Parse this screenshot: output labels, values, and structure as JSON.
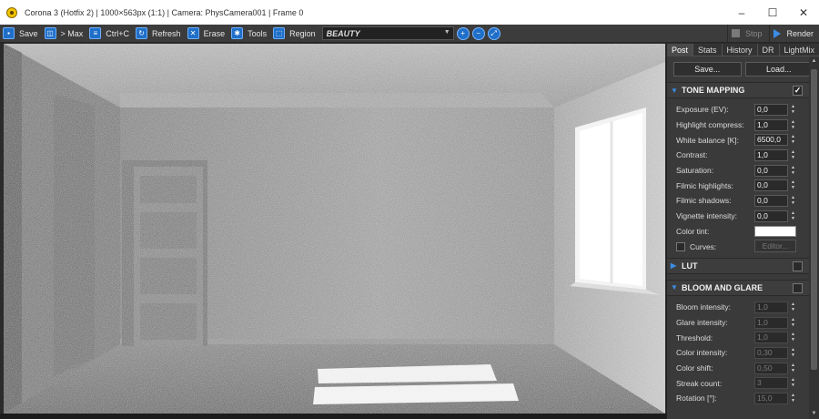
{
  "window": {
    "title": "Corona 3 (Hotfix 2) | 1000×563px (1:1) | Camera: PhysCamera001 | Frame 0",
    "controls": [
      "–",
      "☐",
      "✕"
    ]
  },
  "toolbar": {
    "save": "Save",
    "max": "> Max",
    "copy": "Ctrl+C",
    "refresh": "Refresh",
    "erase": "Erase",
    "tools": "Tools",
    "region": "Region",
    "channel": "BEAUTY",
    "stop": "Stop",
    "render": "Render"
  },
  "panel": {
    "tabs": [
      "Post",
      "Stats",
      "History",
      "DR",
      "LightMix"
    ],
    "save_btn": "Save...",
    "load_btn": "Load...",
    "tone_mapping": {
      "title": "TONE MAPPING",
      "exposure_label": "Exposure (EV):",
      "exposure_value": "0,0",
      "highlight_label": "Highlight compress:",
      "highlight_value": "1,0",
      "wb_label": "White balance [K]:",
      "wb_value": "6500,0",
      "contrast_label": "Contrast:",
      "contrast_value": "1,0",
      "saturation_label": "Saturation:",
      "saturation_value": "0,0",
      "fhl_label": "Filmic highlights:",
      "fhl_value": "0,0",
      "fsh_label": "Filmic shadows:",
      "fsh_value": "0,0",
      "vig_label": "Vignette intensity:",
      "vig_value": "0,0",
      "tint_label": "Color tint:",
      "tint_color": "#ffffff",
      "curves_label": "Curves:",
      "editor_label": "Editor..."
    },
    "lut": {
      "title": "LUT"
    },
    "bloom": {
      "title": "BLOOM AND GLARE",
      "bloom_label": "Bloom intensity:",
      "bloom_value": "1,0",
      "glare_label": "Glare intensity:",
      "glare_value": "1,0",
      "threshold_label": "Threshold:",
      "threshold_value": "1,0",
      "ci_label": "Color intensity:",
      "ci_value": "0,30",
      "cs_label": "Color shift:",
      "cs_value": "0,50",
      "streak_label": "Streak count:",
      "streak_value": "3",
      "rotation_label": "Rotation [°]:",
      "rotation_value": "15,0"
    }
  },
  "colors": {
    "accent": "#1f6fc8",
    "panel_bg": "#3a3a3a",
    "toolbar_bg": "#3c3c3c"
  }
}
